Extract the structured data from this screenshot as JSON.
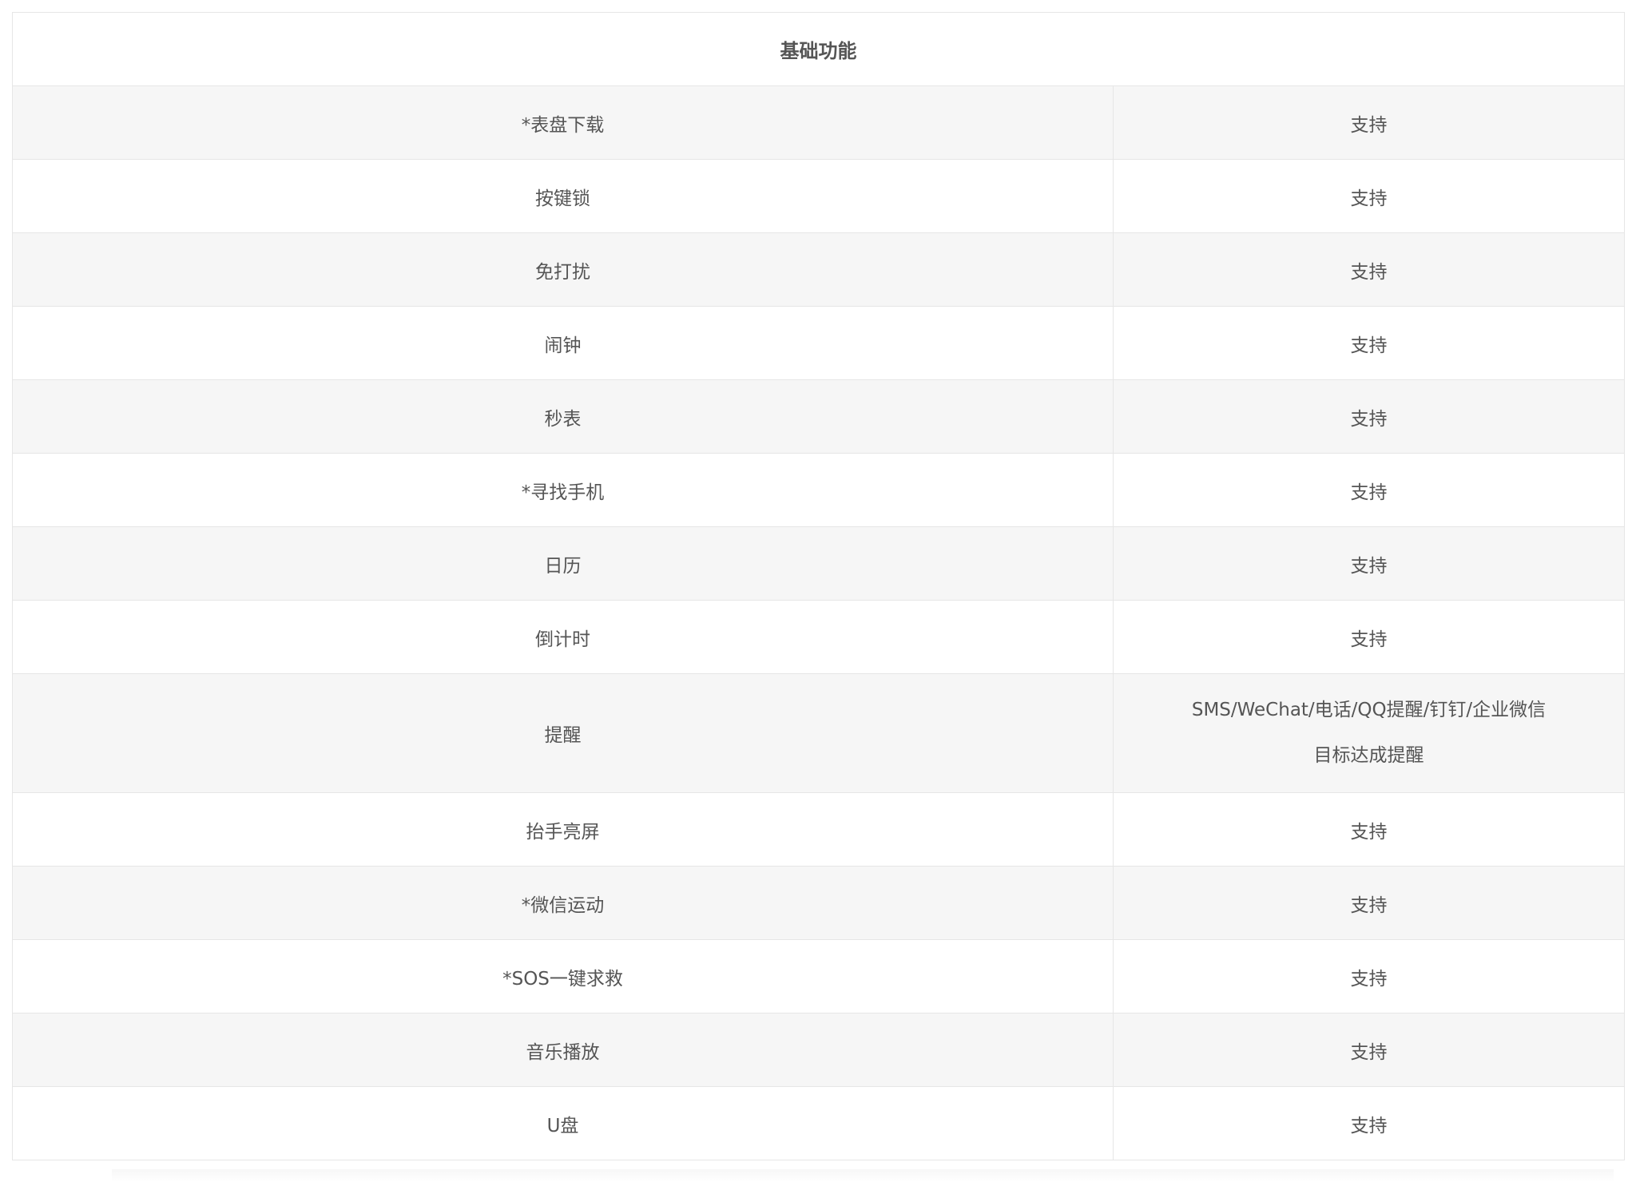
{
  "table": {
    "header": "基础功能",
    "rows": [
      {
        "feature": "*表盘下载",
        "value": "支持"
      },
      {
        "feature": "按键锁",
        "value": "支持"
      },
      {
        "feature": "免打扰",
        "value": "支持"
      },
      {
        "feature": "闹钟",
        "value": "支持"
      },
      {
        "feature": "秒表",
        "value": "支持"
      },
      {
        "feature": "*寻找手机",
        "value": "支持"
      },
      {
        "feature": "日历",
        "value": "支持"
      },
      {
        "feature": "倒计时",
        "value": "支持"
      },
      {
        "feature": "提醒",
        "value_lines": [
          "SMS/WeChat/电话/QQ提醒/钉钉/企业微信",
          "目标达成提醒"
        ]
      },
      {
        "feature": "抬手亮屏",
        "value": "支持"
      },
      {
        "feature": "*微信运动",
        "value": "支持"
      },
      {
        "feature": "*SOS一键求救",
        "value": "支持"
      },
      {
        "feature": "音乐播放",
        "value": "支持"
      },
      {
        "feature": "U盘",
        "value": "支持"
      }
    ]
  }
}
